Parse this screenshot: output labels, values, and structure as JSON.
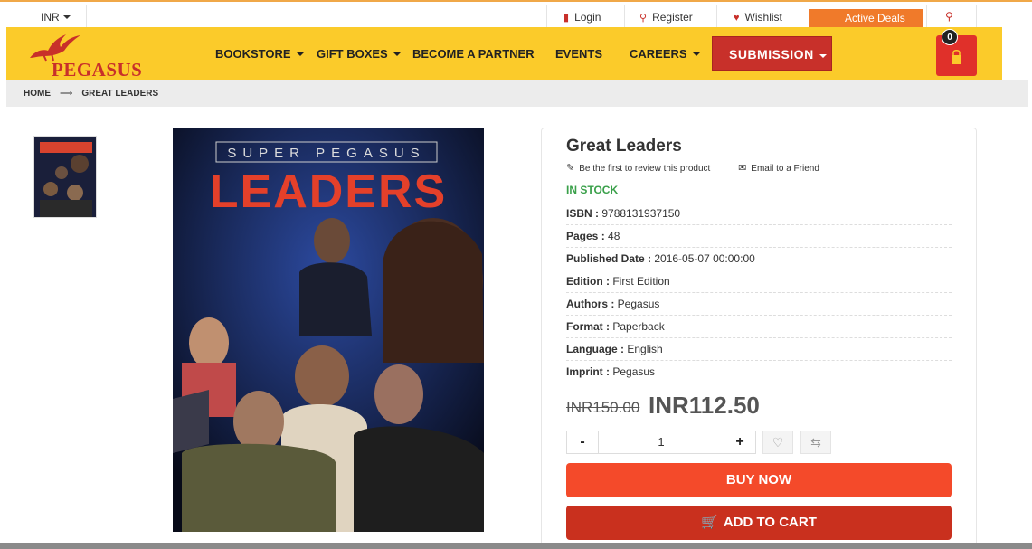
{
  "topbar": {
    "currency": "INR",
    "login": "Login",
    "register": "Register",
    "wishlist": "Wishlist",
    "active_deals": "Active Deals"
  },
  "header": {
    "logo_text": "PEGASUS",
    "nav": [
      "BOOKSTORE",
      "GIFT BOXES",
      "BECOME A PARTNER",
      "EVENTS",
      "CAREERS"
    ],
    "submission": "SUBMISSION",
    "cart_count": "0",
    "brand_color": "#fbcb2a",
    "accent_color": "#c8302a"
  },
  "breadcrumb": {
    "home": "HOME",
    "current": "GREAT LEADERS"
  },
  "cover": {
    "series": "SUPER PEGASUS",
    "title": "LEADERS"
  },
  "product": {
    "title": "Great Leaders",
    "review_link": "Be the first to review this product",
    "email_link": "Email to a Friend",
    "stock": "IN STOCK",
    "attributes": [
      {
        "label": "ISBN :",
        "value": "9788131937150"
      },
      {
        "label": "Pages :",
        "value": "48"
      },
      {
        "label": "Published Date :",
        "value": "2016-05-07 00:00:00"
      },
      {
        "label": "Edition :",
        "value": "First Edition"
      },
      {
        "label": "Authors :",
        "value": "Pegasus"
      },
      {
        "label": "Format :",
        "value": "Paperback"
      },
      {
        "label": "Language :",
        "value": "English"
      },
      {
        "label": "Imprint :",
        "value": "Pegasus"
      }
    ],
    "old_price": "INR150.00",
    "price": "INR112.50",
    "quantity": "1",
    "qty_minus": "-",
    "qty_plus": "+",
    "buy_now": "BUY NOW",
    "add_to_cart": "ADD TO CART"
  }
}
